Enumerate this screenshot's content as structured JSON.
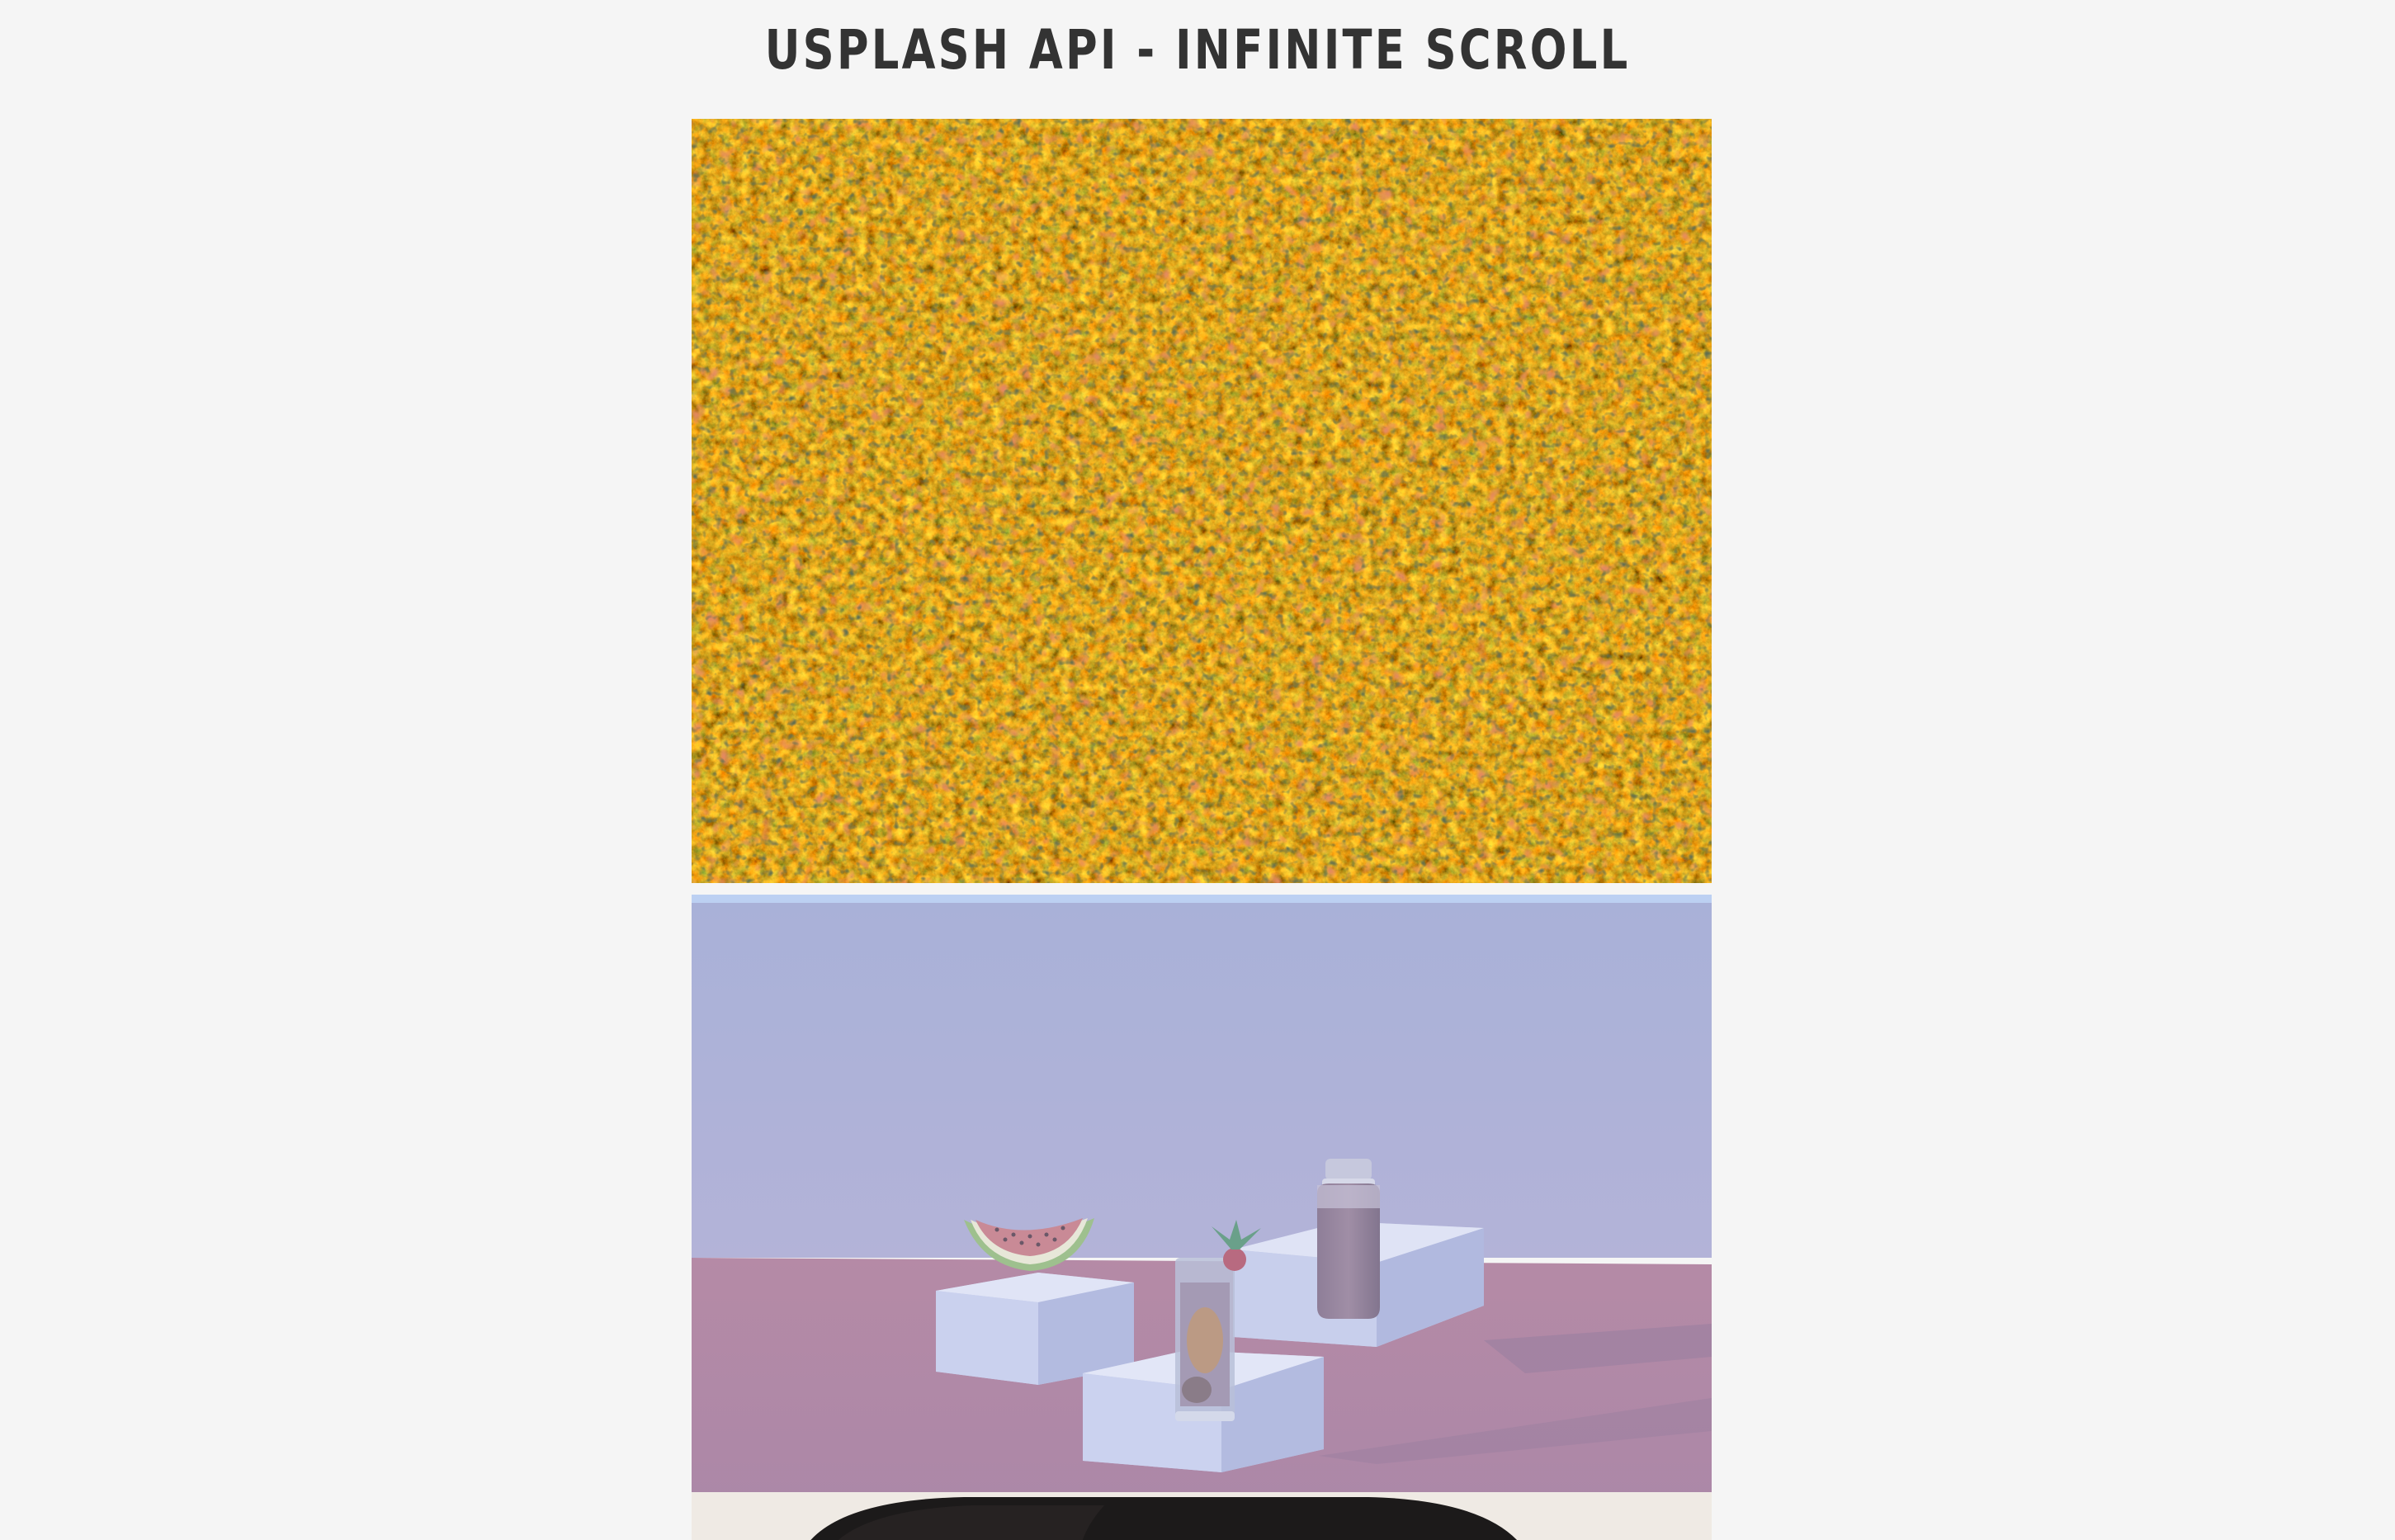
{
  "header": {
    "title": "Usplash API - Infinite Scroll"
  },
  "feed": {
    "images": [
      {
        "subject": "aerial-autumn-forest",
        "dominant_color": "#8a6a22"
      },
      {
        "subject": "pastel-still-life-watermelon-drinks",
        "dominant_color": "#aeb3d6"
      },
      {
        "subject": "portrait-dark-hair",
        "dominant_color": "#efeae4"
      }
    ]
  },
  "colors": {
    "background": "#f5f5f5",
    "title_text": "#333333",
    "pastel_wall": "#afb2d8",
    "pastel_floor": "#ad8aa6",
    "strip_blue": "#bcd0f2"
  }
}
